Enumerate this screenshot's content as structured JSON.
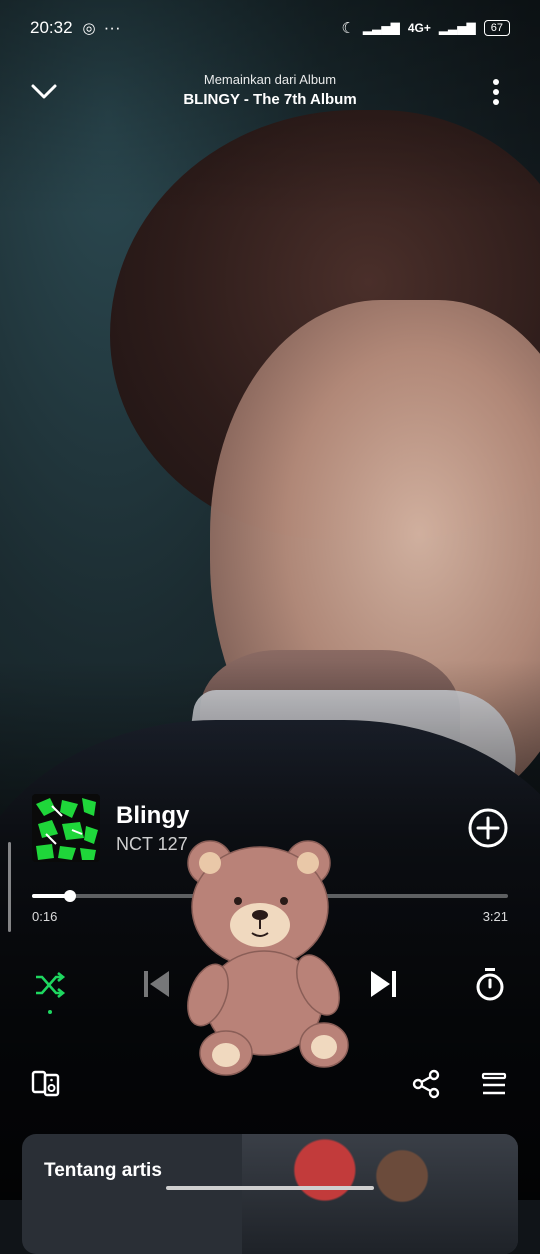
{
  "status": {
    "time": "20:32",
    "battery": "67",
    "network": "4G+"
  },
  "header": {
    "context": "Memainkan dari Album",
    "album": "BLINGY - The 7th Album"
  },
  "track": {
    "title": "Blingy",
    "artist": "NCT 127"
  },
  "progress": {
    "elapsed": "0:16",
    "duration": "3:21",
    "fraction": 0.08
  },
  "card": {
    "label": "Tentang artis"
  },
  "colors": {
    "accent": "#1ed760"
  },
  "icons": {
    "collapse": "chevron-down-icon",
    "menu": "more-vertical-icon",
    "add": "add-circle-icon",
    "shuffle": "shuffle-icon",
    "previous": "skip-previous-icon",
    "next": "skip-next-icon",
    "timer": "sleep-timer-icon",
    "devices": "connect-device-icon",
    "share": "share-icon",
    "queue": "queue-icon"
  }
}
